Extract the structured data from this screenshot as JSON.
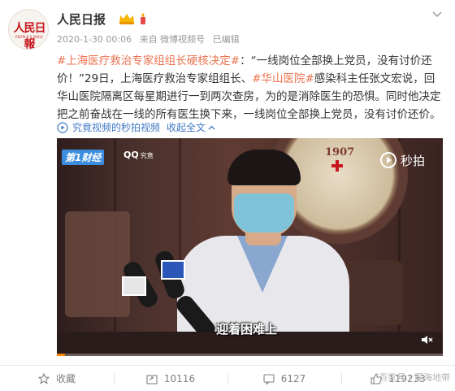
{
  "author": {
    "name": "人民日报",
    "logo_cn": "人民日報",
    "logo_en": "PEOPLE'S DAILY"
  },
  "post": {
    "time": "2020-1-30 00:06",
    "source": "来自 微博视频号",
    "edited": "已编辑",
    "topic": "#上海医疗救治专家组组长硬核决定#",
    "quote": "：“一线岗位全部换上党员，没有讨价还价！”29日，上海医疗救治专家组组长、",
    "hospital_tag": "#华山医院#",
    "rest": "感染科主任张文宏说，回华山医院隔离区每星期进行一到两次查房，为的是消除医生的恐惧。同时他决定把之前奋战在一线的所有医生换下来，一线岗位全部换上党员，没有讨价还价。",
    "video_link": "究竟视频的秒拍视频",
    "collapse": "收起全文"
  },
  "video": {
    "channel1": "第1财经",
    "channel2": "QQ",
    "channel2_sub": "究竟",
    "watermark": "秒拍",
    "emblem_year": "1907",
    "subtitle": "迎着困难上",
    "progress": 0.02
  },
  "actions": {
    "favorite": "收藏",
    "repost": "10116",
    "comment": "6127",
    "like": "119233"
  },
  "site_watermark": "百家号 / 深海地带",
  "colors": {
    "topic": "#eb7350",
    "link": "#3e77c6",
    "progress": "#ff8200"
  }
}
